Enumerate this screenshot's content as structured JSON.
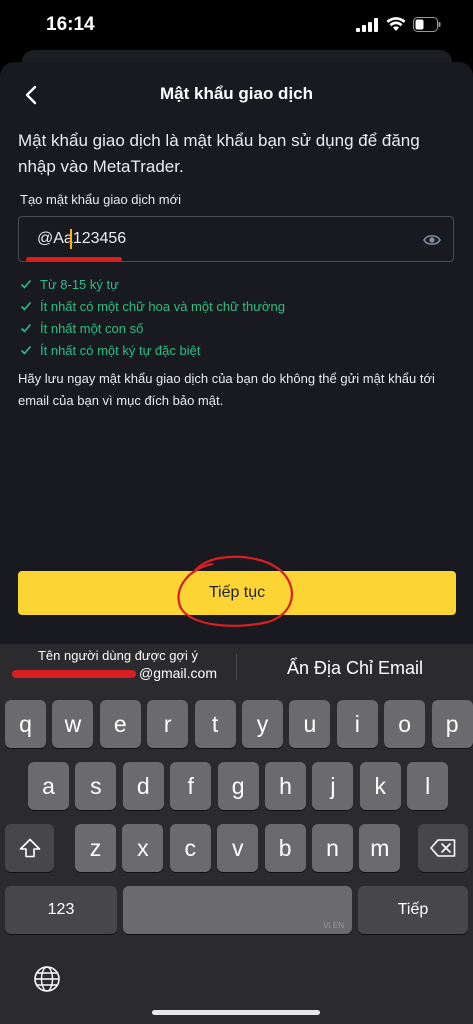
{
  "status_bar": {
    "time": "16:14"
  },
  "header": {
    "title": "Mật khẩu giao dịch"
  },
  "description": "Mật khẩu giao dịch là mật khẩu bạn sử dụng để đăng nhập vào MetaTrader.",
  "password_field": {
    "label": "Tạo mật khẩu giao dịch mới",
    "value": "@Aa123456"
  },
  "rules": [
    "Từ 8-15 ký tự",
    "Ít nhất có một chữ hoa và một chữ thường",
    "Ít nhất một con số",
    "Ít nhất có một ký tự đặc biệt"
  ],
  "notice": "Hãy lưu ngay mật khẩu giao dịch của bạn do không thể gửi mật khẩu tới email của bạn vì mục đích bảo mật.",
  "continue_label": "Tiếp tục",
  "keyboard": {
    "suggestion_title": "Tên người dùng được gợi ý",
    "suggestion_email": "@gmail.com",
    "hide_email_label": "Ẩn Địa Chỉ Email",
    "row1": [
      "q",
      "w",
      "e",
      "r",
      "t",
      "y",
      "u",
      "i",
      "o",
      "p"
    ],
    "row2": [
      "a",
      "s",
      "d",
      "f",
      "g",
      "h",
      "j",
      "k",
      "l"
    ],
    "row3": [
      "z",
      "x",
      "c",
      "v",
      "b",
      "n",
      "m"
    ],
    "numbers_key": "123",
    "return_key": "Tiếp",
    "space_hint": "VI EN"
  },
  "colors": {
    "accent_yellow": "#fcd535",
    "success_green": "#2ebd85",
    "annotation_red": "#d81e22"
  }
}
